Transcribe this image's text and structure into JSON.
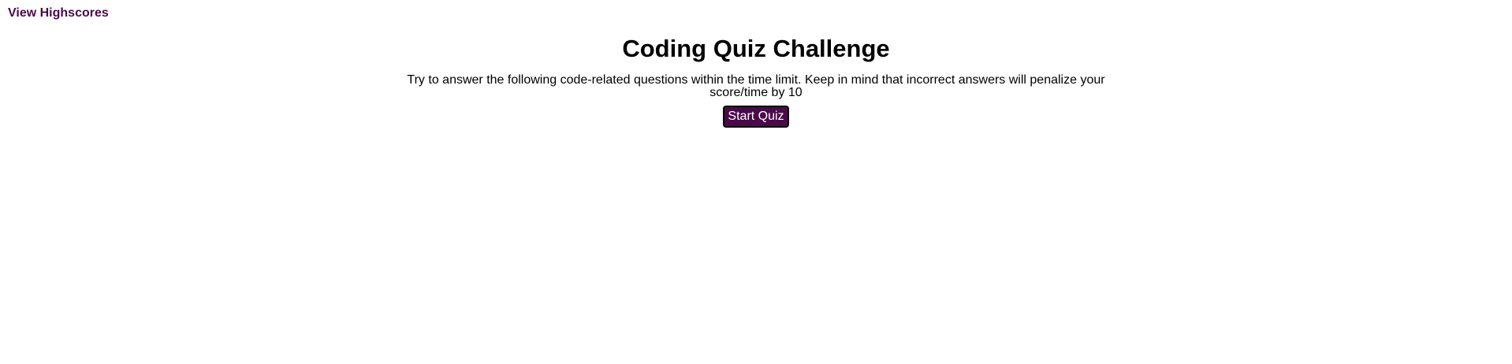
{
  "header": {
    "highscores_link": "View Highscores"
  },
  "main": {
    "title": "Coding Quiz Challenge",
    "intro_text": "Try to answer the following code-related questions within the time limit. Keep in mind that incorrect answers will penalize your score/time by 10",
    "start_button_label": "Start Quiz"
  },
  "colors": {
    "accent": "#4a0a4a",
    "button_text": "#ffffff",
    "background": "#ffffff"
  }
}
